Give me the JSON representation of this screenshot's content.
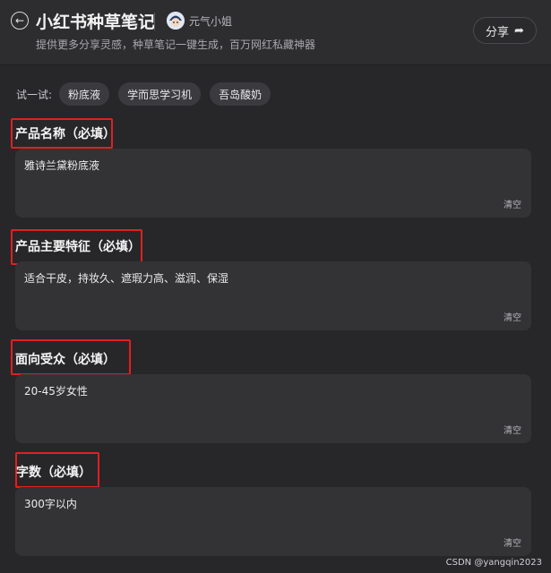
{
  "header": {
    "title": "小红书种草笔记",
    "author": "元气小姐",
    "subtitle": "提供更多分享灵感，种草笔记一键生成，百万网红私藏神器",
    "share_label": "分享"
  },
  "try": {
    "label": "试一试:",
    "chips": [
      "粉底液",
      "学而思学习机",
      "吾岛酸奶"
    ]
  },
  "fields": [
    {
      "label": "产品名称（必填）",
      "value": "雅诗兰黛粉底液",
      "clear": "清空"
    },
    {
      "label": "产品主要特征（必填）",
      "value": "适合干皮，持妆久、遮瑕力高、滋润、保湿",
      "clear": "清空"
    },
    {
      "label": "面向受众（必填）",
      "value": "20-45岁女性",
      "clear": "清空"
    },
    {
      "label": "字数（必填）",
      "value": "300字以内",
      "clear": "清空"
    }
  ],
  "watermark": "CSDN @yangqin2023",
  "icons": {
    "back": "back-arrow-icon",
    "share": "share-arrow-icon"
  },
  "colors": {
    "background": "#27272a",
    "field": "#333336",
    "highlight": "#e02020"
  }
}
